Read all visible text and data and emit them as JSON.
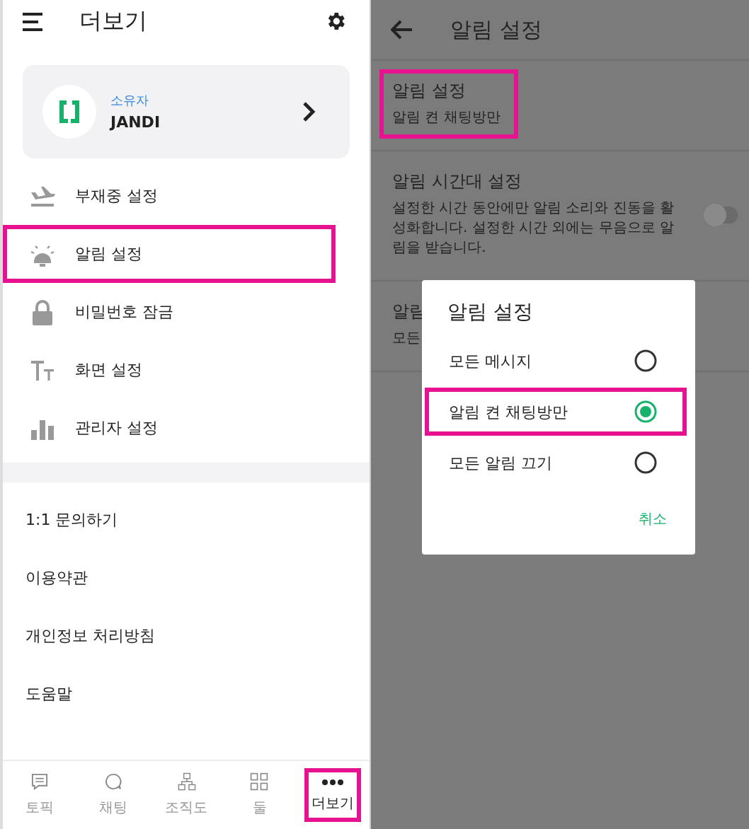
{
  "left": {
    "title": "더보기",
    "profile": {
      "role": "소유자",
      "name": "JANDI"
    },
    "menu": [
      {
        "kind": "plane",
        "label": "부재중 설정",
        "highlighted": false
      },
      {
        "kind": "bell",
        "label": "알림 설정",
        "highlighted": true
      },
      {
        "kind": "lock",
        "label": "비밀번호 잠금",
        "highlighted": false
      },
      {
        "kind": "text",
        "label": "화면 설정",
        "highlighted": false
      },
      {
        "kind": "chart",
        "label": "관리자 설정",
        "highlighted": false
      }
    ],
    "links": [
      "1:1 문의하기",
      "이용약관",
      "개인정보 처리방침",
      "도움말"
    ],
    "nav": [
      {
        "kind": "topic",
        "label": "토픽",
        "selected": false,
        "highlighted": false
      },
      {
        "kind": "chat",
        "label": "채팅",
        "selected": false,
        "highlighted": false
      },
      {
        "kind": "org",
        "label": "조직도",
        "selected": false,
        "highlighted": false
      },
      {
        "kind": "grid",
        "label": "둘",
        "selected": false,
        "highlighted": false
      },
      {
        "kind": "more",
        "label": "더보기",
        "selected": true,
        "highlighted": true
      }
    ]
  },
  "right": {
    "title": "알림 설정",
    "rows": [
      {
        "kind": "plain",
        "title": "알림 설정",
        "subtitle": "알림 켠 채팅방만",
        "highlighted": true
      },
      {
        "kind": "toggle",
        "title": "알림 시간대 설정",
        "subtitle": "설정한 시간 동안에만 알림 소리와 진동을 활성화합니다. 설정한 시간 외에는 무음으로 알림을 받습니다.",
        "on": false,
        "highlighted": false
      },
      {
        "kind": "plain",
        "title": "알림",
        "subtitle": "모든",
        "highlighted": false
      }
    ],
    "dialog": {
      "title": "알림 설정",
      "options": [
        {
          "label": "모든 메시지",
          "selected": false,
          "highlighted": false
        },
        {
          "label": "알림 켠 채팅방만",
          "selected": true,
          "highlighted": true
        },
        {
          "label": "모든 알림 끄기",
          "selected": false,
          "highlighted": false
        }
      ],
      "cancel": "취소"
    }
  }
}
